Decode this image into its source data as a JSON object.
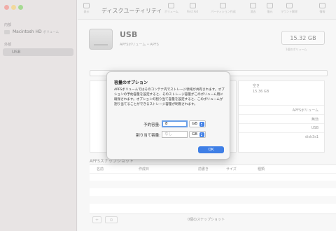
{
  "toolbar": {
    "title": "ディスクユーティリティ",
    "buttons": [
      {
        "label": "表示"
      },
      {
        "label": "ボリューム"
      },
      {
        "label": "First Aid"
      },
      {
        "label": "パーティション作成"
      },
      {
        "label": "消去"
      },
      {
        "label": "復元"
      },
      {
        "label": "マウント解除"
      },
      {
        "label": "情報"
      }
    ]
  },
  "sidebar": {
    "sections": [
      {
        "header": "内部",
        "items": [
          {
            "label": "Macintosh HD",
            "sub": "ボリューム"
          }
        ]
      },
      {
        "header": "外部",
        "items": [
          {
            "label": "USB"
          }
        ]
      }
    ],
    "selected": "USB"
  },
  "volume": {
    "name": "USB",
    "subtitle": "APFSボリューム • APFS",
    "size": "15.32 GB",
    "size_sub": "1個のボリューム",
    "usage_tag_color": "#4a7fd0"
  },
  "info_top": {
    "label": "空き",
    "value": "15.36 GB"
  },
  "info_rows": [
    {
      "value": "APFSボリューム"
    },
    {
      "value": "無効"
    },
    {
      "value": "USB"
    },
    {
      "value": "disk3s1"
    }
  ],
  "snapshots": {
    "title": "APFSスナップショット",
    "columns": [
      "名前",
      "作成日",
      "前書き",
      "サイズ",
      "種類"
    ],
    "count_text": "0個のスナップショット",
    "add_label": "+",
    "more_label": "⊙"
  },
  "dialog": {
    "title": "容量のオプション",
    "description": "APFSボリュームではそのコンテナ内でストレージ領域が共有されます。オプションの予約容量を設定すると、そのストレージ容量がこのボリューム用に確保されます。オプションの割り当て容量を設定すると、このボリュームが割り当てることができるストレージ容量が制限されます。",
    "reserved_label": "予約容量:",
    "reserved_value": "8",
    "reserved_unit": "GB",
    "quota_label": "割り当て容量:",
    "quota_placeholder": "なし",
    "quota_unit": "GB",
    "ok_label": "OK",
    "accent_color": "#3f7fe6"
  }
}
